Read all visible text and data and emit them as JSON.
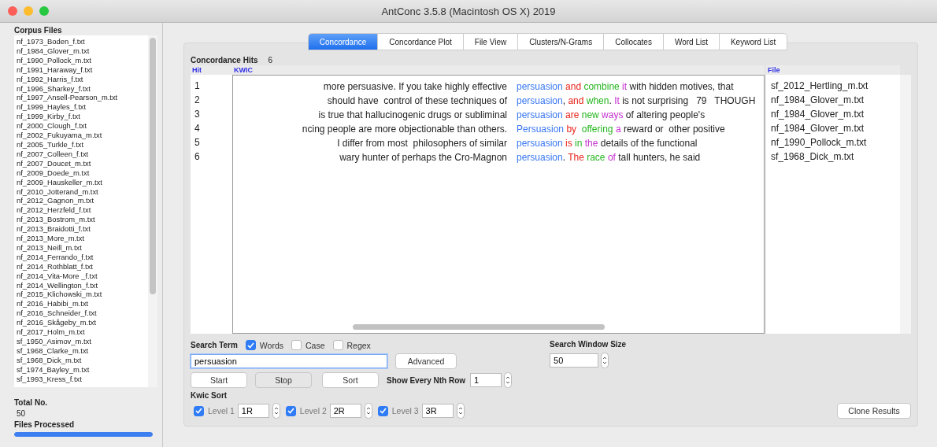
{
  "window": {
    "title": "AntConc 3.5.8 (Macintosh OS X) 2019"
  },
  "sidebar": {
    "title": "Corpus Files",
    "files": [
      "nf_1973_Boden_f.txt",
      "nf_1984_Glover_m.txt",
      "nf_1990_Pollock_m.txt",
      "nf_1991_Haraway_f.txt",
      "nf_1992_Harris_f.txt",
      "nf_1996_Sharkey_f.txt",
      "nf_1997_Ansell-Pearson_m.txt",
      "nf_1999_Hayles_f.txt",
      "nf_1999_Kirby_f.txt",
      "nf_2000_Clough_f.txt",
      "nf_2002_Fukuyama_m.txt",
      "nf_2005_Turkle_f.txt",
      "nf_2007_Colleen_f.txt",
      "nf_2007_Doucet_m.txt",
      "nf_2009_Doede_m.txt",
      "nf_2009_Hauskeller_m.txt",
      "nf_2010_Jotterand_m.txt",
      "nf_2012_Gagnon_m.txt",
      "nf_2012_Herzfeld_f.txt",
      "nf_2013_Bostrom_m.txt",
      "nf_2013_Braidotti_f.txt",
      "nf_2013_More_m.txt",
      "nf_2013_Neill_m.txt",
      "nf_2014_Ferrando_f.txt",
      "nf_2014_Rothblatt_f.txt",
      "nf_2014_Vita-More _f.txt",
      "nf_2014_Wellington_f.txt",
      "nf_2015_Klichowski_m.txt",
      "nf_2016_Habibi_m.txt",
      "nf_2016_Schneider_f.txt",
      "nf_2016_Skågeby_m.txt",
      "nf_2017_Holm_m.txt",
      "sf_1950_Asimov_m.txt",
      "sf_1968_Clarke_m.txt",
      "sf_1968_Dick_m.txt",
      "sf_1974_Bayley_m.txt",
      "sf_1993_Kress_f.txt"
    ],
    "total_label": "Total No.",
    "total": "50",
    "processed_label": "Files Processed",
    "progress": {
      "level": 1
    }
  },
  "tabs": [
    {
      "label": "Concordance",
      "selected": true
    },
    {
      "label": "Concordance Plot",
      "selected": false
    },
    {
      "label": "File View",
      "selected": false
    },
    {
      "label": "Clusters/N-Grams",
      "selected": false
    },
    {
      "label": "Collocates",
      "selected": false
    },
    {
      "label": "Word List",
      "selected": false
    },
    {
      "label": "Keyword List",
      "selected": false
    }
  ],
  "hits": {
    "label": "Concordance Hits",
    "count": "6"
  },
  "table": {
    "columns": [
      "Hit",
      "KWIC",
      "File"
    ],
    "rows": [
      {
        "hit": "1",
        "left": "more persuasive. If you take highly effective",
        "right": [
          {
            "text": "persuasion",
            "kind": "node"
          },
          {
            "text": " and",
            "kind": "level1"
          },
          {
            "text": " combine",
            "kind": "level2"
          },
          {
            "text": " it",
            "kind": "level3"
          },
          {
            "text": " with hidden motives, that",
            "kind": "plain"
          }
        ],
        "file": "sf_2012_Hertling_m.txt"
      },
      {
        "hit": "2",
        "left": "should have  control of these techniques of",
        "right": [
          {
            "text": "persuasion",
            "kind": "node"
          },
          {
            "text": ",",
            "kind": "plain"
          },
          {
            "text": " and",
            "kind": "level1"
          },
          {
            "text": " when",
            "kind": "level2"
          },
          {
            "text": ".",
            "kind": "plain"
          },
          {
            "text": " It",
            "kind": "level3"
          },
          {
            "text": " is not surprising   79   THOUGH",
            "kind": "plain"
          }
        ],
        "file": "nf_1984_Glover_m.txt"
      },
      {
        "hit": "3",
        "left": "is true that hallucinogenic drugs or subliminal",
        "right": [
          {
            "text": "persuasion",
            "kind": "node"
          },
          {
            "text": " are",
            "kind": "level1"
          },
          {
            "text": " new",
            "kind": "level2"
          },
          {
            "text": " ways",
            "kind": "level3"
          },
          {
            "text": " of altering people's",
            "kind": "plain"
          }
        ],
        "file": "nf_1984_Glover_m.txt"
      },
      {
        "hit": "4",
        "left": "ncing people are more objectionable than others.",
        "right": [
          {
            "text": "Persuasion",
            "kind": "node"
          },
          {
            "text": " by",
            "kind": "level1"
          },
          {
            "text": "  offering",
            "kind": "level2"
          },
          {
            "text": " a",
            "kind": "level3"
          },
          {
            "text": " reward or  other positive",
            "kind": "plain"
          }
        ],
        "file": "nf_1984_Glover_m.txt"
      },
      {
        "hit": "5",
        "left": "I differ from most  philosophers of similar",
        "right": [
          {
            "text": "persuasion",
            "kind": "node"
          },
          {
            "text": " is",
            "kind": "level1"
          },
          {
            "text": " in",
            "kind": "level2"
          },
          {
            "text": " the",
            "kind": "level3"
          },
          {
            "text": " details of the functional",
            "kind": "plain"
          }
        ],
        "file": "nf_1990_Pollock_m.txt"
      },
      {
        "hit": "6",
        "left": "wary hunter of perhaps the Cro-Magnon",
        "right": [
          {
            "text": "persuasion",
            "kind": "node"
          },
          {
            "text": ".",
            "kind": "plain"
          },
          {
            "text": " The",
            "kind": "level1"
          },
          {
            "text": " race",
            "kind": "level2"
          },
          {
            "text": " of",
            "kind": "level3"
          },
          {
            "text": " tall hunters, he said",
            "kind": "plain"
          }
        ],
        "file": "sf_1968_Dick_m.txt"
      }
    ]
  },
  "search": {
    "label": "Search Term",
    "options": [
      {
        "label": "Words",
        "checked": true
      },
      {
        "label": "Case",
        "checked": false
      },
      {
        "label": "Regex",
        "checked": false
      }
    ],
    "value": "persuasion",
    "advanced": "Advanced",
    "buttons": [
      {
        "label": "Start",
        "disabled": false
      },
      {
        "label": "Stop",
        "disabled": true
      },
      {
        "label": "Sort",
        "disabled": false
      }
    ],
    "nth_label": "Show Every Nth Row",
    "nth": "1"
  },
  "window_size": {
    "label": "Search Window Size",
    "value": "50"
  },
  "kwic_sort": {
    "label": "Kwic Sort",
    "levels": [
      {
        "label": "Level 1",
        "checked": true,
        "value": "1R"
      },
      {
        "label": "Level 2",
        "checked": true,
        "value": "2R"
      },
      {
        "label": "Level 3",
        "checked": true,
        "value": "3R"
      }
    ]
  },
  "clone": "Clone Results"
}
